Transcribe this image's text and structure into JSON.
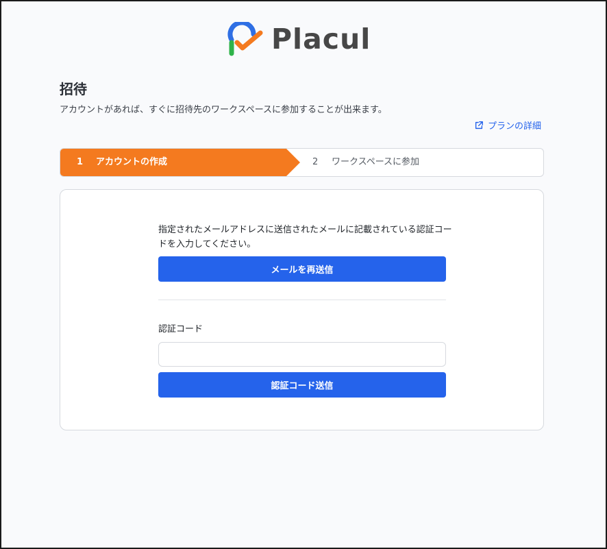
{
  "brand": {
    "name": "Placul",
    "logo_icon": "placul-logo-icon",
    "colors": {
      "orange": "#f47a1f",
      "blue": "#2563eb",
      "green": "#2fb34a"
    }
  },
  "header": {
    "title": "招待",
    "subtitle": "アカウントがあれば、すぐに招待先のワークスペースに参加することが出来ます。",
    "plan_link": {
      "icon": "external-link-icon",
      "label": "プランの詳細"
    }
  },
  "stepper": {
    "active_index": 1,
    "steps": [
      {
        "number": "1",
        "label": "アカウントの作成"
      },
      {
        "number": "2",
        "label": "ワークスペースに参加"
      }
    ]
  },
  "verification": {
    "instruction": "指定されたメールアドレスに送信されたメールに記載されている認証コードを入力してください。",
    "resend_button": "メールを再送信",
    "code_label": "認証コード",
    "code_value": "",
    "code_placeholder": "",
    "submit_button": "認証コード送信"
  }
}
